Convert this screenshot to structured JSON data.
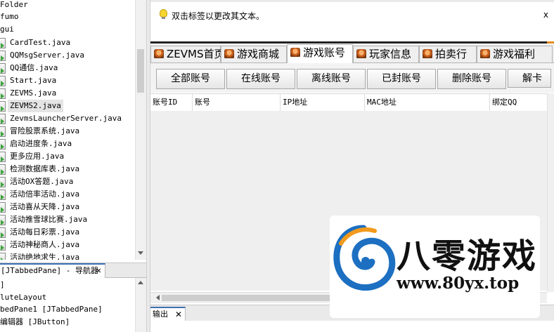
{
  "tree": {
    "top_items": [
      "Folder",
      "fumo",
      "gui"
    ],
    "files": [
      "CardTest.java",
      "QQMsgServer.java",
      "QQ通信.java",
      "Start.java",
      "ZEVMS.java",
      "ZEVMS2.java",
      "ZevmsLauncherServer.java",
      "冒险股票系统.java",
      "启动进度条.java",
      "更多应用.java",
      "检测数据库表.java",
      "活动OX答题.java",
      "活动倍率活动.java",
      "活动喜从天降.java",
      "活动推雪球比赛.java",
      "活动每日彩票.java",
      "活动神秘商人.java",
      "活动绝地求生.java"
    ],
    "selected": "ZEVMS2.java"
  },
  "navigator": {
    "tab_label": "[JTabbedPane] - 导航器",
    "close": "✕",
    "rows": [
      "]",
      "luteLayout",
      "bedPane1 [JTabbedPane]",
      "编辑器 [JButton]"
    ]
  },
  "hint": {
    "text": "双击标签以更改其文本。",
    "close": "x"
  },
  "tabs": [
    "ZEVMS首页",
    "游戏商城",
    "游戏账号",
    "玩家信息",
    "拍卖行",
    "游戏福利"
  ],
  "active_tab": "游戏账号",
  "buttons": [
    "全部账号",
    "在线账号",
    "离线账号",
    "已封账号",
    "删除账号",
    "解卡账"
  ],
  "table": {
    "columns": [
      "账号ID",
      "账号",
      "IP地址",
      "MAC地址",
      "绑定QQ"
    ]
  },
  "output": {
    "tab_label": "输出",
    "close": "✕"
  },
  "watermark": {
    "title": "八零游戏",
    "url": "www.80yx.top"
  },
  "colors": {
    "accent_blue": "#3f6fb0",
    "run_green": "#3aa53a",
    "hint_orange": "#e58b1f",
    "logo_blue": "#1c6fc1",
    "logo_orange": "#f29a1b"
  }
}
